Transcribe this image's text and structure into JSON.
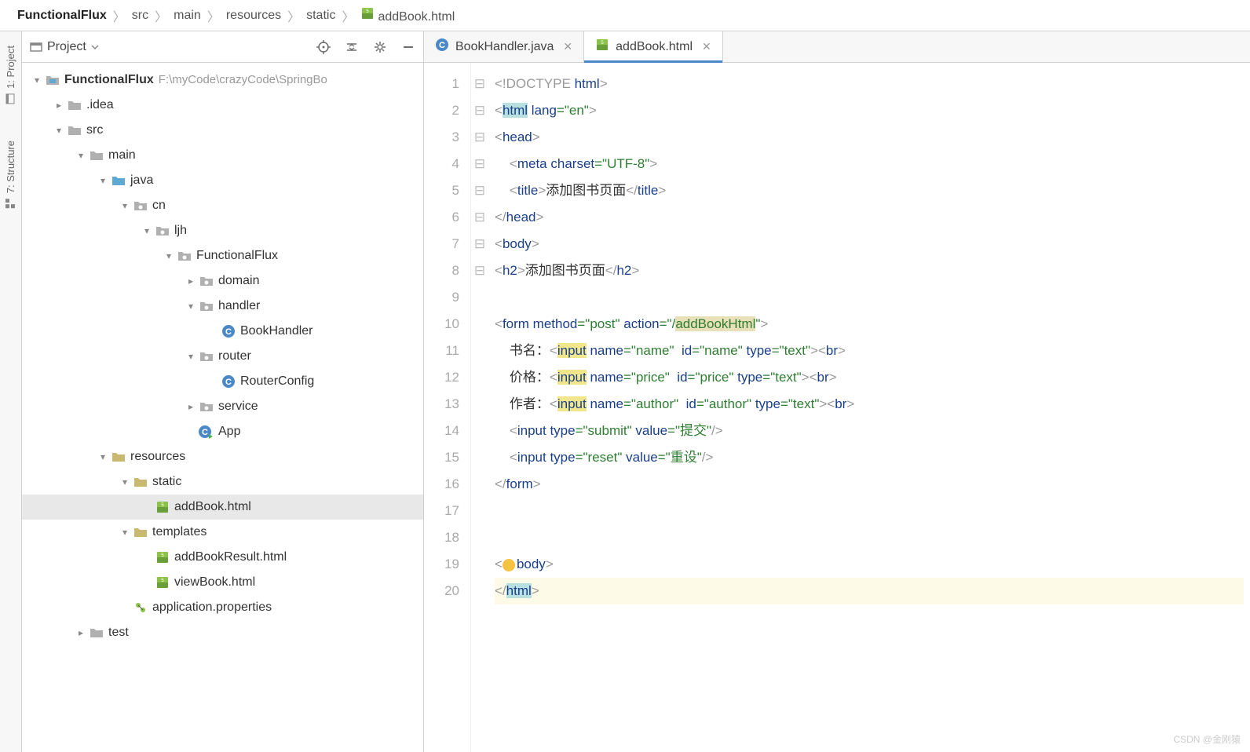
{
  "breadcrumb": [
    {
      "label": "FunctionalFlux",
      "bold": true,
      "icon": null
    },
    {
      "label": "src",
      "bold": false,
      "icon": null
    },
    {
      "label": "main",
      "bold": false,
      "icon": null
    },
    {
      "label": "resources",
      "bold": false,
      "icon": null
    },
    {
      "label": "static",
      "bold": false,
      "icon": null
    },
    {
      "label": "addBook.html",
      "bold": false,
      "icon": "html"
    }
  ],
  "gutter": [
    {
      "label": "1: Project",
      "icon": "project"
    },
    {
      "label": "7: Structure",
      "icon": "structure"
    }
  ],
  "project_panel": {
    "title": "Project",
    "tree": [
      {
        "depth": 0,
        "arrow": "down",
        "icon": "module",
        "label": "FunctionalFlux",
        "dim": "F:\\myCode\\crazyCode\\SpringBo",
        "sel": false
      },
      {
        "depth": 1,
        "arrow": "right",
        "icon": "folder",
        "label": ".idea",
        "sel": false
      },
      {
        "depth": 1,
        "arrow": "down",
        "icon": "folder",
        "label": "src",
        "sel": false
      },
      {
        "depth": 2,
        "arrow": "down",
        "icon": "folder",
        "label": "main",
        "sel": false
      },
      {
        "depth": 3,
        "arrow": "down",
        "icon": "folder-src",
        "label": "java",
        "sel": false
      },
      {
        "depth": 4,
        "arrow": "down",
        "icon": "package",
        "label": "cn",
        "sel": false
      },
      {
        "depth": 5,
        "arrow": "down",
        "icon": "package",
        "label": "ljh",
        "sel": false
      },
      {
        "depth": 6,
        "arrow": "down",
        "icon": "package",
        "label": "FunctionalFlux",
        "sel": false
      },
      {
        "depth": 7,
        "arrow": "right",
        "icon": "package",
        "label": "domain",
        "sel": false
      },
      {
        "depth": 7,
        "arrow": "down",
        "icon": "package",
        "label": "handler",
        "sel": false
      },
      {
        "depth": 8,
        "arrow": "",
        "icon": "class",
        "label": "BookHandler",
        "sel": false
      },
      {
        "depth": 7,
        "arrow": "down",
        "icon": "package",
        "label": "router",
        "sel": false
      },
      {
        "depth": 8,
        "arrow": "",
        "icon": "class",
        "label": "RouterConfig",
        "sel": false
      },
      {
        "depth": 7,
        "arrow": "right",
        "icon": "package",
        "label": "service",
        "sel": false
      },
      {
        "depth": 7,
        "arrow": "",
        "icon": "class-run",
        "label": "App",
        "sel": false
      },
      {
        "depth": 3,
        "arrow": "down",
        "icon": "folder-res",
        "label": "resources",
        "sel": false
      },
      {
        "depth": 4,
        "arrow": "down",
        "icon": "folder-res",
        "label": "static",
        "sel": false
      },
      {
        "depth": 5,
        "arrow": "",
        "icon": "html",
        "label": "addBook.html",
        "sel": true
      },
      {
        "depth": 4,
        "arrow": "down",
        "icon": "folder-res",
        "label": "templates",
        "sel": false
      },
      {
        "depth": 5,
        "arrow": "",
        "icon": "html",
        "label": "addBookResult.html",
        "sel": false
      },
      {
        "depth": 5,
        "arrow": "",
        "icon": "html",
        "label": "viewBook.html",
        "sel": false
      },
      {
        "depth": 4,
        "arrow": "",
        "icon": "props",
        "label": "application.properties",
        "sel": false
      },
      {
        "depth": 2,
        "arrow": "right",
        "icon": "folder",
        "label": "test",
        "sel": false
      }
    ]
  },
  "tabs": [
    {
      "label": "BookHandler.java",
      "icon": "class",
      "active": false
    },
    {
      "label": "addBook.html",
      "icon": "html",
      "active": true
    }
  ],
  "code_lines": 20,
  "watermark": "CSDN @金刚猿"
}
